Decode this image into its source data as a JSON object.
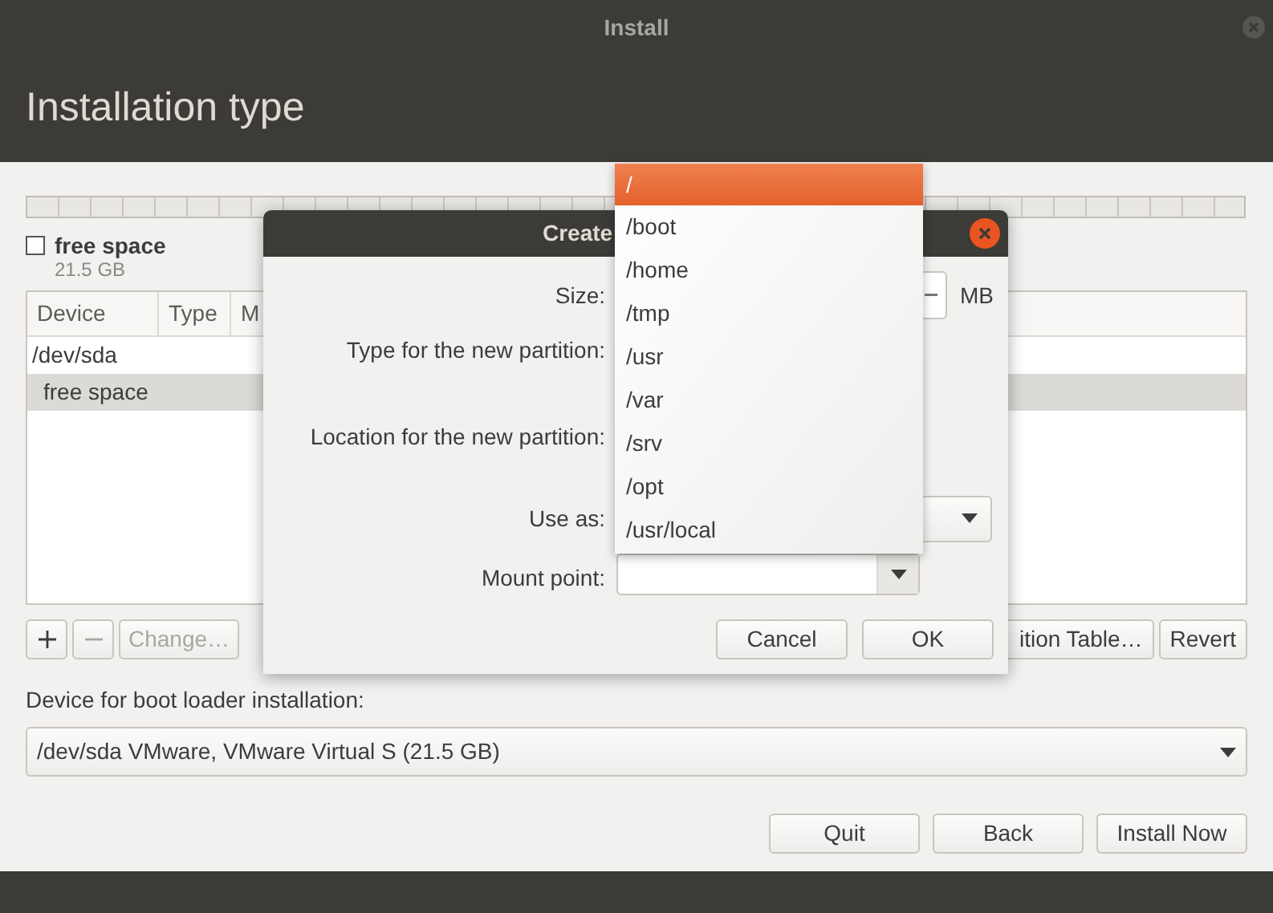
{
  "window": {
    "title": "Install"
  },
  "header": {
    "title": "Installation type"
  },
  "legend": {
    "label": "free space",
    "size": "21.5 GB",
    "checked": false
  },
  "table": {
    "columns": [
      "Device",
      "Type",
      "M"
    ],
    "rows": [
      {
        "device": "/dev/sda",
        "selected": false,
        "children": [
          {
            "device": "free space",
            "selected": true
          }
        ]
      }
    ]
  },
  "table_buttons": [
    {
      "kind": "add",
      "disabled": false
    },
    {
      "kind": "remove",
      "disabled": true
    },
    {
      "kind": "text",
      "label": "Change…",
      "disabled": true
    }
  ],
  "right_buttons": [
    {
      "label": "ition Table…"
    },
    {
      "label": "Revert"
    }
  ],
  "boot_loader": {
    "label": "Device for boot loader installation:",
    "value": "/dev/sda VMware, VMware Virtual S (21.5 GB)"
  },
  "footer_buttons": [
    {
      "label": "Quit"
    },
    {
      "label": "Back"
    },
    {
      "label": "Install Now"
    }
  ],
  "dialog": {
    "title": "Create",
    "fields": [
      {
        "label": "Size:",
        "kind": "spin",
        "unit": "MB"
      },
      {
        "label": "Type for the new partition:",
        "kind": "radio"
      },
      {
        "label": "Location for the new partition:",
        "kind": "radio"
      },
      {
        "label": "Use as:",
        "kind": "combo"
      },
      {
        "label": "Mount point:",
        "kind": "mount"
      }
    ],
    "buttons": [
      "Cancel",
      "OK"
    ]
  },
  "menu": {
    "items": [
      {
        "label": "/",
        "selected": true
      },
      {
        "label": "/boot",
        "selected": false
      },
      {
        "label": "/home",
        "selected": false
      },
      {
        "label": "/tmp",
        "selected": false
      },
      {
        "label": "/usr",
        "selected": false
      },
      {
        "label": "/var",
        "selected": false
      },
      {
        "label": "/srv",
        "selected": false
      },
      {
        "label": "/opt",
        "selected": false
      },
      {
        "label": "/usr/local",
        "selected": false
      }
    ]
  }
}
